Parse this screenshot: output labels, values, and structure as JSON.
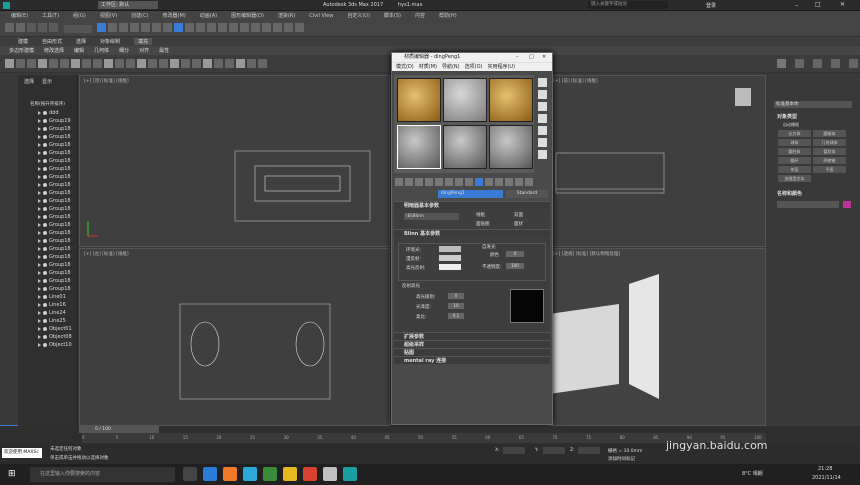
{
  "titlebar": {
    "app_title": "Autodesk 3ds Max 2017",
    "file_name": "hys1.max",
    "workspace": "工作区: 默认",
    "search_placeholder": "键入关键字或短语",
    "login": "登录"
  },
  "menubar": [
    "编辑(E)",
    "工具(T)",
    "组(G)",
    "视图(V)",
    "创建(C)",
    "修改器(M)",
    "动画(A)",
    "图形编辑器(D)",
    "渲染(R)",
    "Civil View",
    "自定义(U)",
    "脚本(S)",
    "内容",
    "帮助(H)"
  ],
  "ribbon_tabs": [
    "建模",
    "自由形式",
    "选择",
    "对象绘制",
    "填充"
  ],
  "ribbon_row": [
    "多边形建模",
    "修改选择",
    "编辑",
    "几何体",
    "细分",
    "对齐",
    "属性"
  ],
  "scene_explorer": {
    "tabs": [
      "选择",
      "显示"
    ],
    "header": "名称(按升序排序)",
    "items": [
      "ddd",
      "Group19",
      "Group18",
      "Group18",
      "Group18",
      "Group18",
      "Group18",
      "Group18",
      "Group18",
      "Group18",
      "Group18",
      "Group18",
      "Group18",
      "Group18",
      "Group18",
      "Group18",
      "Group18",
      "Group18",
      "Group18",
      "Group18",
      "Group18",
      "Group18",
      "Group18",
      "Line01",
      "Line16",
      "Line24",
      "Line25",
      "Object01",
      "Object08",
      "Object10"
    ]
  },
  "viewports": {
    "top_left": "[+] [顶] [标准] [线框]",
    "top_right": "[+] [前] [标准] [线框]",
    "bottom_left": "[+] [左] [标准] [线框]",
    "bottom_right": "[+] [透视] [标准] [默认明暗处理]"
  },
  "material_editor": {
    "title": "材质编辑器 - dingPeng1",
    "menu": [
      "模式(D)",
      "材质(M)",
      "导航(N)",
      "选项(O)",
      "实用程序(U)"
    ],
    "material_name": "dingPeng1",
    "material_type": "Standard",
    "rollouts": {
      "shader_basic": "明暗器基本参数",
      "shader_type": "(B)Blinn",
      "wire": "线框",
      "two_sided": "双面",
      "face_map": "面贴图",
      "faceted": "面状",
      "blinn_basic": "Blinn 基本参数",
      "self_illum": "自发光",
      "color": "颜色",
      "ambient": "环境光:",
      "diffuse": "漫反射:",
      "specular": "高光反射:",
      "opacity": "不透明度:",
      "opacity_value": "100",
      "color_value": "0",
      "spec_highlights": "反射高光",
      "spec_level": "高光级别:",
      "spec_level_value": "0",
      "glossiness": "光泽度:",
      "glossiness_value": "10",
      "soften": "柔化:",
      "soften_value": "0.1",
      "extended": "扩展参数",
      "supersampling": "超级采样",
      "maps": "贴图",
      "mental_ray": "mental ray 连接"
    }
  },
  "command_panel": {
    "dropdown": "标准基本体",
    "object_type": "对象类型",
    "autogrid": "自动栅格",
    "buttons": [
      "长方体",
      "圆锥体",
      "球体",
      "几何球体",
      "圆柱体",
      "管状体",
      "圆环",
      "四棱锥",
      "茶壶",
      "平面",
      "加强型文本"
    ],
    "name_color": "名称和颜色"
  },
  "timeline": {
    "frame": "0 / 100",
    "ticks": [
      "0",
      "5",
      "10",
      "15",
      "20",
      "25",
      "30",
      "35",
      "40",
      "45",
      "50",
      "55",
      "60",
      "65",
      "70",
      "75",
      "80",
      "85",
      "90",
      "95",
      "100"
    ]
  },
  "status": {
    "welcome": "欢迎使用 MAXSc",
    "line1": "未选定任何对象",
    "line2": "单击或单击并拖动以选择对象",
    "x_label": "X:",
    "y_label": "Y:",
    "z_label": "Z:",
    "grid": "栅格 = 10.0mm",
    "add_time": "添加时间标记"
  },
  "taskbar": {
    "search_placeholder": "在这里输入你要搜索的内容",
    "weather": "8°C 晴朗",
    "time": "21:28",
    "date": "2021/11/14"
  },
  "watermark": "jingyan.baidu.com",
  "colors": {
    "accent": "#3a7bd5",
    "bg": "#3a3a3a"
  }
}
